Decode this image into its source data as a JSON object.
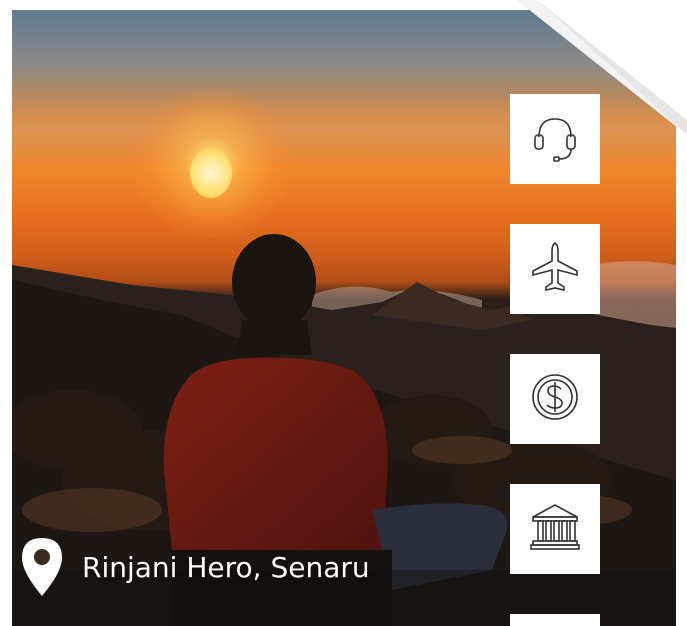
{
  "location": {
    "icon": "map-pin-icon",
    "text": "Rinjani Hero, Senaru"
  },
  "side_tiles": [
    {
      "icon": "headset-icon"
    },
    {
      "icon": "airplane-icon"
    },
    {
      "icon": "dollar-coin-icon"
    },
    {
      "icon": "bank-icon"
    },
    {
      "icon": "partial-tile"
    }
  ],
  "colors": {
    "tile_bg": "#ffffff",
    "icon_stroke": "#333333",
    "text": "#ffffff"
  }
}
